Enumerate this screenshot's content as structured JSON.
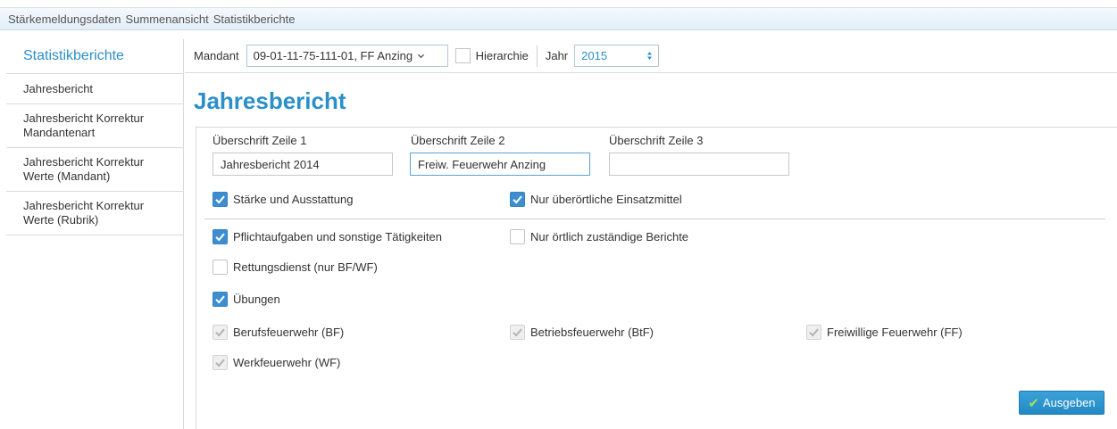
{
  "topnav": {
    "items": [
      "Stärkemeldungsdaten",
      "Summenansicht",
      "Statistikberichte"
    ]
  },
  "sidebar": {
    "title": "Statistikberichte",
    "items": [
      {
        "label": "Jahresbericht"
      },
      {
        "label": "Jahresbericht Korrektur Mandantenart"
      },
      {
        "label": "Jahresbericht Korrektur Werte (Mandant)"
      },
      {
        "label": "Jahresbericht Korrektur Werte (Rubrik)"
      }
    ]
  },
  "filter": {
    "mandant_label": "Mandant",
    "mandant_value": "09-01-11-75-111-01, FF Anzing",
    "hierarchie_label": "Hierarchie",
    "hierarchie_checked": false,
    "jahr_label": "Jahr",
    "jahr_value": "2015"
  },
  "page": {
    "title": "Jahresbericht"
  },
  "form": {
    "header1_label": "Überschrift Zeile 1",
    "header1_value": "Jahresbericht 2014",
    "header2_label": "Überschrift Zeile 2",
    "header2_value": "Freiw. Feuerwehr Anzing",
    "header3_label": "Überschrift Zeile 3",
    "header3_value": "",
    "checkboxes": {
      "staerke": {
        "label": "Stärke und Ausstattung",
        "state": "checked"
      },
      "ueberoertlich": {
        "label": "Nur überörtliche Einsatzmittel",
        "state": "checked"
      },
      "pflicht": {
        "label": "Pflichtaufgaben und sonstige Tätigkeiten",
        "state": "checked"
      },
      "oertlich": {
        "label": "Nur örtlich zuständige Berichte",
        "state": "unchecked"
      },
      "rettung": {
        "label": "Rettungsdienst (nur BF/WF)",
        "state": "unchecked"
      },
      "uebungen": {
        "label": "Übungen",
        "state": "checked"
      },
      "berufsfw": {
        "label": "Berufsfeuerwehr (BF)",
        "state": "disabled-checked"
      },
      "betriebsfw": {
        "label": "Betriebsfeuerwehr (BtF)",
        "state": "disabled-checked"
      },
      "freiwfw": {
        "label": "Freiwillige Feuerwehr (FF)",
        "state": "disabled-checked"
      },
      "werkfw": {
        "label": "Werkfeuerwehr (WF)",
        "state": "disabled-checked"
      }
    },
    "submit_label": "Ausgeben"
  },
  "colors": {
    "accent": "#2b8fc8",
    "checkbox_checked": "#3d8ed1",
    "button": "#2389c4",
    "button_tick": "#9ee05a"
  }
}
